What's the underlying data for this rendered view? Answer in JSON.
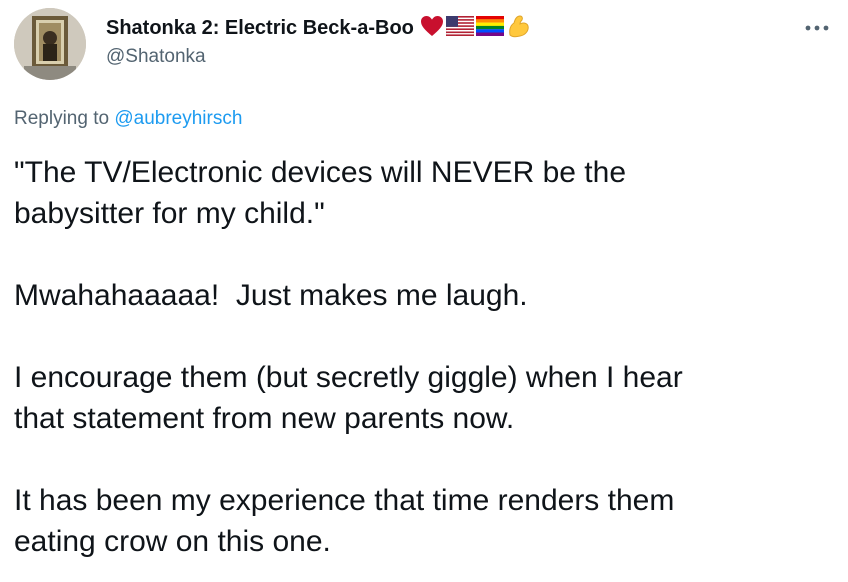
{
  "tweet": {
    "author": {
      "display_name": "Shatonka 2: Electric Beck-a-Boo",
      "handle": "@Shatonka",
      "name_emojis": [
        "heart-icon",
        "us-flag-icon",
        "rainbow-flag-icon",
        "flexed-biceps-icon"
      ]
    },
    "more_icon": "ellipsis-icon",
    "replying": {
      "prefix": "Replying to",
      "mention": "@aubreyhirsch"
    },
    "paragraphs": [
      {
        "lines": [
          "\"The TV/Electronic devices will NEVER be the",
          "babysitter for my child.\""
        ]
      },
      {
        "lines": [
          "Mwahahaaaaa!  Just makes me laugh."
        ]
      },
      {
        "lines": [
          "I encourage them (but secretly giggle) when I hear",
          "that statement from new parents now."
        ]
      },
      {
        "lines": [
          "It has been my experience that time renders them",
          "eating crow on this one."
        ]
      }
    ]
  },
  "colors": {
    "text_primary": "#0f1419",
    "text_secondary": "#536471",
    "link": "#1d9bf0",
    "heart": "#c8102e"
  }
}
